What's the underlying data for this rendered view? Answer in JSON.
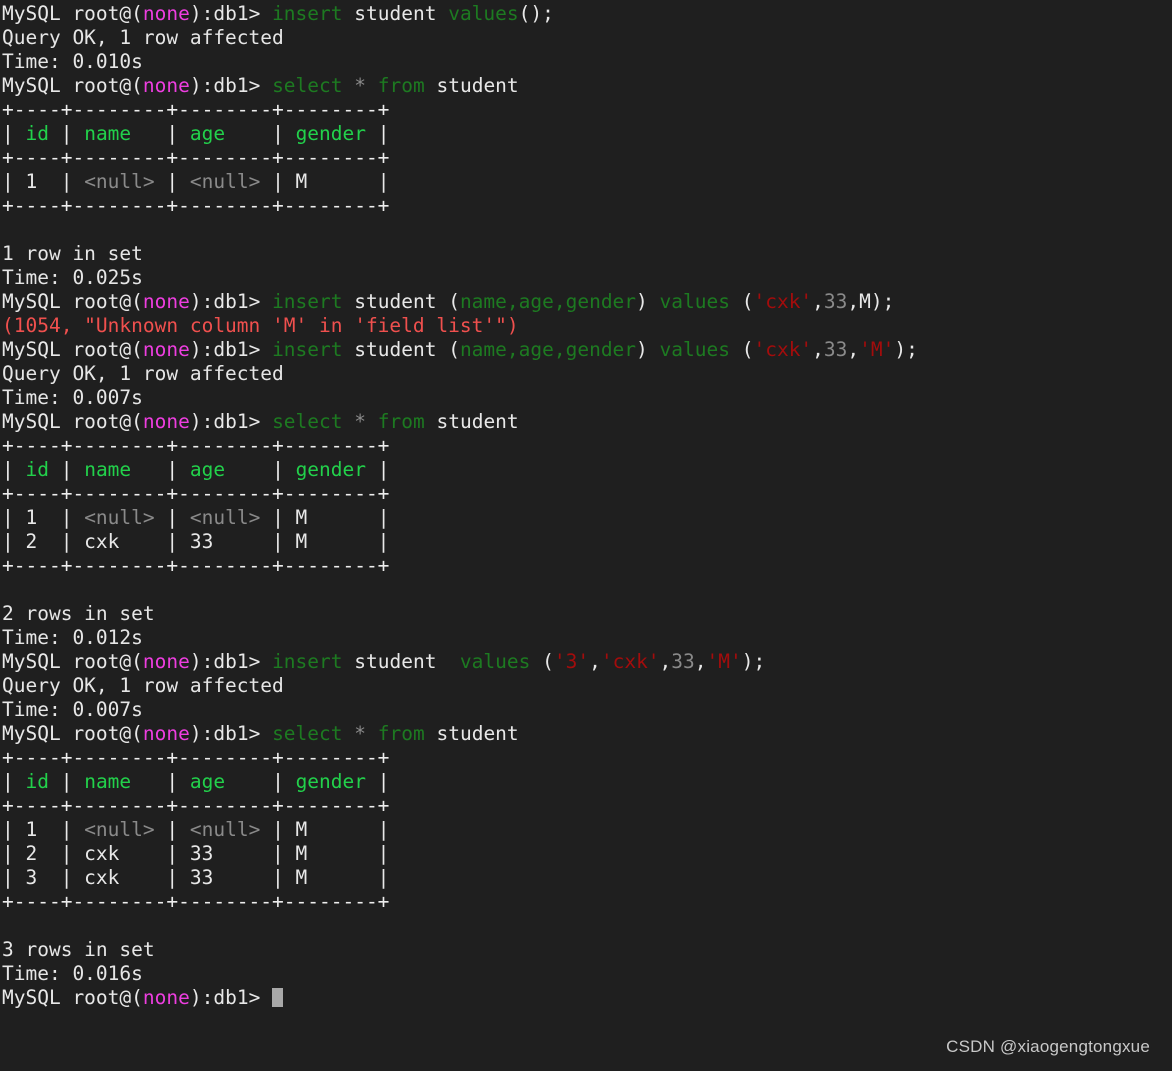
{
  "terminal": {
    "background_color": "#1f1f1f",
    "foreground_color": "#e8e8e8",
    "prompt": {
      "user_host": "MySQL root@",
      "open_paren": "(",
      "database": "none",
      "close_paren": ")",
      "suffix": ":db1> "
    },
    "colors": {
      "prompt_db": "#ee3ee0",
      "keyword": "#1d7a21",
      "table_header": "#22d14b",
      "string_literal": "#a30c0c",
      "number_literal": "#8a8a8a",
      "null_value": "#8a8a8a",
      "error": "#f0504e",
      "border": "#ededed",
      "cursor": "#a8a8a8"
    },
    "cursor_visible": true
  },
  "session": {
    "commands": [
      {
        "sql": "insert student values();",
        "result_status": "Query OK, 1 row affected",
        "time": "Time: 0.010s"
      },
      {
        "sql": "select * from student",
        "result_status": "1 row in set",
        "time": "Time: 0.025s"
      },
      {
        "sql": "insert student (name,age,gender) values ('cxk',33,M);",
        "error": "(1054, \"Unknown column 'M' in 'field list'\")"
      },
      {
        "sql": "insert student (name,age,gender) values ('cxk',33,'M');",
        "result_status": "Query OK, 1 row affected",
        "time": "Time: 0.007s"
      },
      {
        "sql": "select * from student",
        "result_status": "2 rows in set",
        "time": "Time: 0.012s"
      },
      {
        "sql": "insert student  values ('3','cxk',33,'M');",
        "result_status": "Query OK, 1 row affected",
        "time": "Time: 0.007s"
      },
      {
        "sql": "select * from student",
        "result_status": "3 rows in set",
        "time": "Time: 0.016s"
      }
    ],
    "result_tables": [
      {
        "border": "+----+--------+--------+--------+",
        "columns": [
          "id",
          "name",
          "age",
          "gender"
        ],
        "header_row": "| id | name   | age    | gender |",
        "rows": [
          {
            "text": "| 1  | <null> | <null> | M      |",
            "values": [
              "1",
              "<null>",
              "<null>",
              "M"
            ]
          }
        ],
        "row_count_label": "1 row in set",
        "time_label": "Time: 0.025s"
      },
      {
        "border": "+----+--------+--------+--------+",
        "columns": [
          "id",
          "name",
          "age",
          "gender"
        ],
        "header_row": "| id | name   | age    | gender |",
        "rows": [
          {
            "text": "| 1  | <null> | <null> | M      |",
            "values": [
              "1",
              "<null>",
              "<null>",
              "M"
            ]
          },
          {
            "text": "| 2  | cxk    | 33     | M      |",
            "values": [
              "2",
              "cxk",
              "33",
              "M"
            ]
          }
        ],
        "row_count_label": "2 rows in set",
        "time_label": "Time: 0.012s"
      },
      {
        "border": "+----+--------+--------+--------+",
        "columns": [
          "id",
          "name",
          "age",
          "gender"
        ],
        "header_row": "| id | name   | age    | gender |",
        "rows": [
          {
            "text": "| 1  | <null> | <null> | M      |",
            "values": [
              "1",
              "<null>",
              "<null>",
              "M"
            ]
          },
          {
            "text": "| 2  | cxk    | 33     | M      |",
            "values": [
              "2",
              "cxk",
              "33",
              "M"
            ]
          },
          {
            "text": "| 3  | cxk    | 33     | M      |",
            "values": [
              "3",
              "cxk",
              "33",
              "M"
            ]
          }
        ],
        "row_count_label": "3 rows in set",
        "time_label": "Time: 0.016s"
      }
    ]
  },
  "lines": {
    "l01": {
      "cmd_insert": "insert",
      "sp1": " ",
      "tbl": "student",
      "sp2": " ",
      "values": "values",
      "tail": "();"
    },
    "l02": "Query OK, 1 row affected",
    "l03": "Time: 0.010s",
    "l04": {
      "select": "select",
      "sp1": " ",
      "star": "*",
      "sp2": " ",
      "from": "from",
      "sp3": " ",
      "tbl": "student"
    },
    "l05": "+----+--------+--------+--------+",
    "l06_pipe_a": "| ",
    "l06_id": "id",
    "l06_pipe_b": " | ",
    "l06_name": "name",
    "l06_pipe_c": "   | ",
    "l06_age": "age",
    "l06_pipe_d": "    | ",
    "l06_gender": "gender",
    "l06_pipe_e": " |",
    "l07": "+----+--------+--------+--------+",
    "row1_a": "| 1  | ",
    "row1_null1": "<null>",
    "row1_b": " | ",
    "row1_null2": "<null>",
    "row1_c": " | M      |",
    "row2_full": "| 2  | cxk    | 33     | M      |",
    "row3_full": "| 3  | cxk    | 33     | M      |",
    "l09": "+----+--------+--------+--------+",
    "blank": " ",
    "l11": "1 row in set",
    "l12": "Time: 0.025s",
    "ins2_kw": "insert",
    "ins2_sp1": " ",
    "ins2_tbl": "student",
    "ins2_open": " (",
    "ins2_cols": "name,age,gender",
    "ins2_close": ") ",
    "ins2_values": "values",
    "ins2_paren1": " (",
    "ins2_str1": "'cxk'",
    "ins2_comma1": ",",
    "ins2_num": "33",
    "ins2_tail": ",M);",
    "err1": "(1054, \"Unknown column 'M' in 'field list'\")",
    "ins3_tail_comma": ",",
    "ins3_str2": "'M'",
    "ins3_end": ");",
    "l16": "Query OK, 1 row affected",
    "l17": "Time: 0.007s",
    "l24": "2 rows in set",
    "l25": "Time: 0.012s",
    "ins4_kw": "insert",
    "ins4_tbl": " student  ",
    "ins4_values": "values",
    "ins4_p1": " (",
    "ins4_s1": "'3'",
    "ins4_c1": ",",
    "ins4_s2": "'cxk'",
    "ins4_c2": ",",
    "ins4_n": "33",
    "ins4_c3": ",",
    "ins4_s3": "'M'",
    "ins4_end": ");",
    "l28": "Query OK, 1 row affected",
    "l29": "Time: 0.007s",
    "l40": "3 rows in set",
    "l41": "Time: 0.016s"
  },
  "watermark": "CSDN @xiaogengtongxue"
}
